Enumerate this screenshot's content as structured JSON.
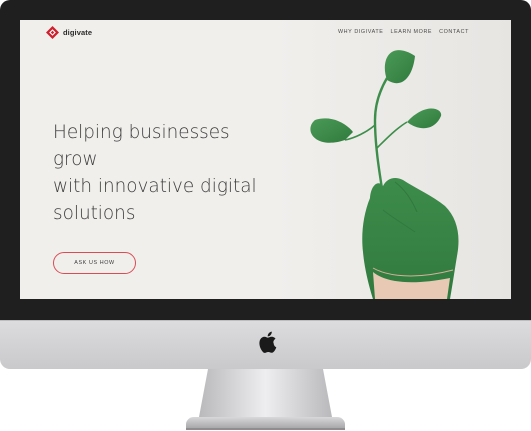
{
  "site": {
    "brand": "digivate",
    "nav": [
      "WHY DIGIVATE",
      "LEARN MORE",
      "CONTACT"
    ],
    "hero": {
      "lines": [
        "Helping businesses",
        "grow",
        "with innovative digital",
        "solutions"
      ],
      "cta_label": "ASK US HOW"
    }
  },
  "icons": {
    "logo": "digivate-logo-icon",
    "device": "apple-logo-icon"
  },
  "colors": {
    "accent": "#d94c55",
    "logo_red": "#d0202e",
    "leaf_green": "#3a8a4a",
    "screen_bg": "#f1efec",
    "bezel": "#1f1f20"
  }
}
